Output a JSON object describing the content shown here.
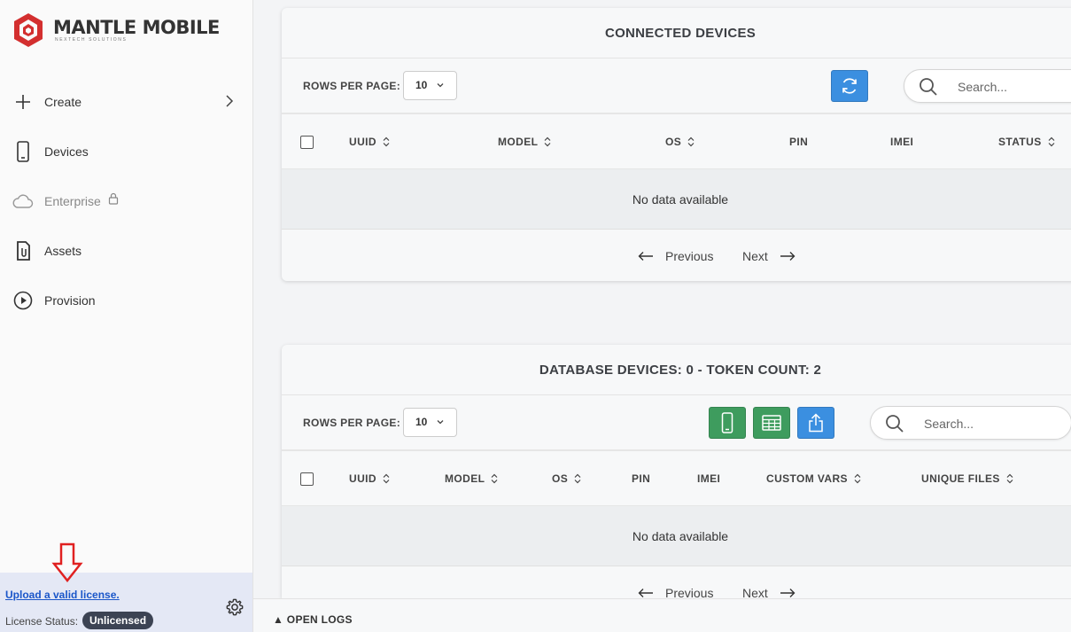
{
  "brand": {
    "name": "MANTLE MOBILE",
    "tagline": "NEXTECH SOLUTIONS",
    "color": "#d32f2f"
  },
  "sidebar": {
    "items": [
      {
        "label": "Create",
        "icon": "plus-icon"
      },
      {
        "label": "Devices",
        "icon": "phone-icon"
      },
      {
        "label": "Enterprise",
        "icon": "cloud-icon",
        "locked": true
      },
      {
        "label": "Assets",
        "icon": "file-icon"
      },
      {
        "label": "Provision",
        "icon": "play-circle-icon"
      }
    ],
    "footer": {
      "upload_link": "Upload a valid license.",
      "license_label": "License Status:",
      "license_status": "Unlicensed"
    }
  },
  "connected": {
    "title": "CONNECTED DEVICES",
    "rows_per_page_label": "ROWS PER PAGE:",
    "rows_per_page": "10",
    "search_placeholder": "Search...",
    "columns": [
      "UUID",
      "MODEL",
      "OS",
      "PIN",
      "IMEI",
      "STATUS"
    ],
    "empty_text": "No data available",
    "prev_label": "Previous",
    "next_label": "Next"
  },
  "database": {
    "title": "DATABASE DEVICES: 0 - TOKEN COUNT: 2",
    "rows_per_page_label": "ROWS PER PAGE:",
    "rows_per_page": "10",
    "search_placeholder": "Search...",
    "columns": [
      "UUID",
      "MODEL",
      "OS",
      "PIN",
      "IMEI",
      "CUSTOM VARS",
      "UNIQUE FILES"
    ],
    "empty_text": "No data available",
    "prev_label": "Previous",
    "next_label": "Next"
  },
  "bottom_bar": {
    "open_logs": "▲ OPEN LOGS"
  },
  "colors": {
    "accent_blue": "#3b8fe0",
    "accent_green": "#3e9c5e",
    "link": "#1a56c9",
    "badge": "#3c4353"
  }
}
